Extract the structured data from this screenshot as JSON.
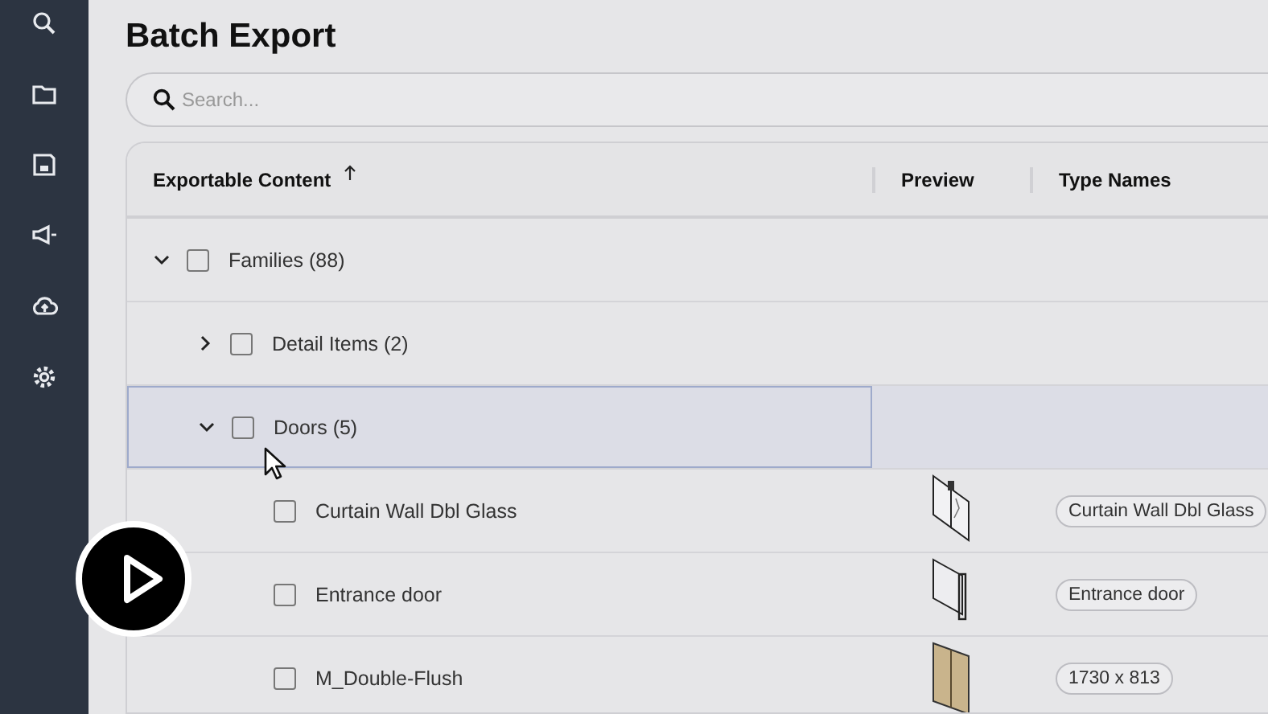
{
  "page": {
    "title": "Batch Export"
  },
  "search": {
    "placeholder": "Search..."
  },
  "table": {
    "columns": [
      {
        "label": "Exportable Content",
        "sorted": true
      },
      {
        "label": "Preview",
        "sorted": false
      },
      {
        "label": "Type Names",
        "sorted": false
      }
    ],
    "rows": [
      {
        "label": "Families (88)",
        "checked": false,
        "expanded": true,
        "selected": false,
        "children": [
          {
            "label": "Detail Items (2)",
            "checked": false,
            "expanded": false,
            "selected": false
          },
          {
            "label": "Doors (5)",
            "checked": false,
            "expanded": true,
            "selected": true,
            "children": [
              {
                "label": "Curtain Wall Dbl Glass",
                "checked": false,
                "selected": false,
                "preview": true,
                "type_name": "Curtain Wall Dbl Glass"
              },
              {
                "label": "Entrance door",
                "checked": false,
                "selected": false,
                "preview": true,
                "type_name": "Entrance door"
              },
              {
                "label": "M_Double-Flush",
                "checked": false,
                "selected": false,
                "preview": true,
                "type_name": "1730 x 813"
              }
            ]
          }
        ]
      }
    ]
  },
  "video": {
    "playing": false
  }
}
